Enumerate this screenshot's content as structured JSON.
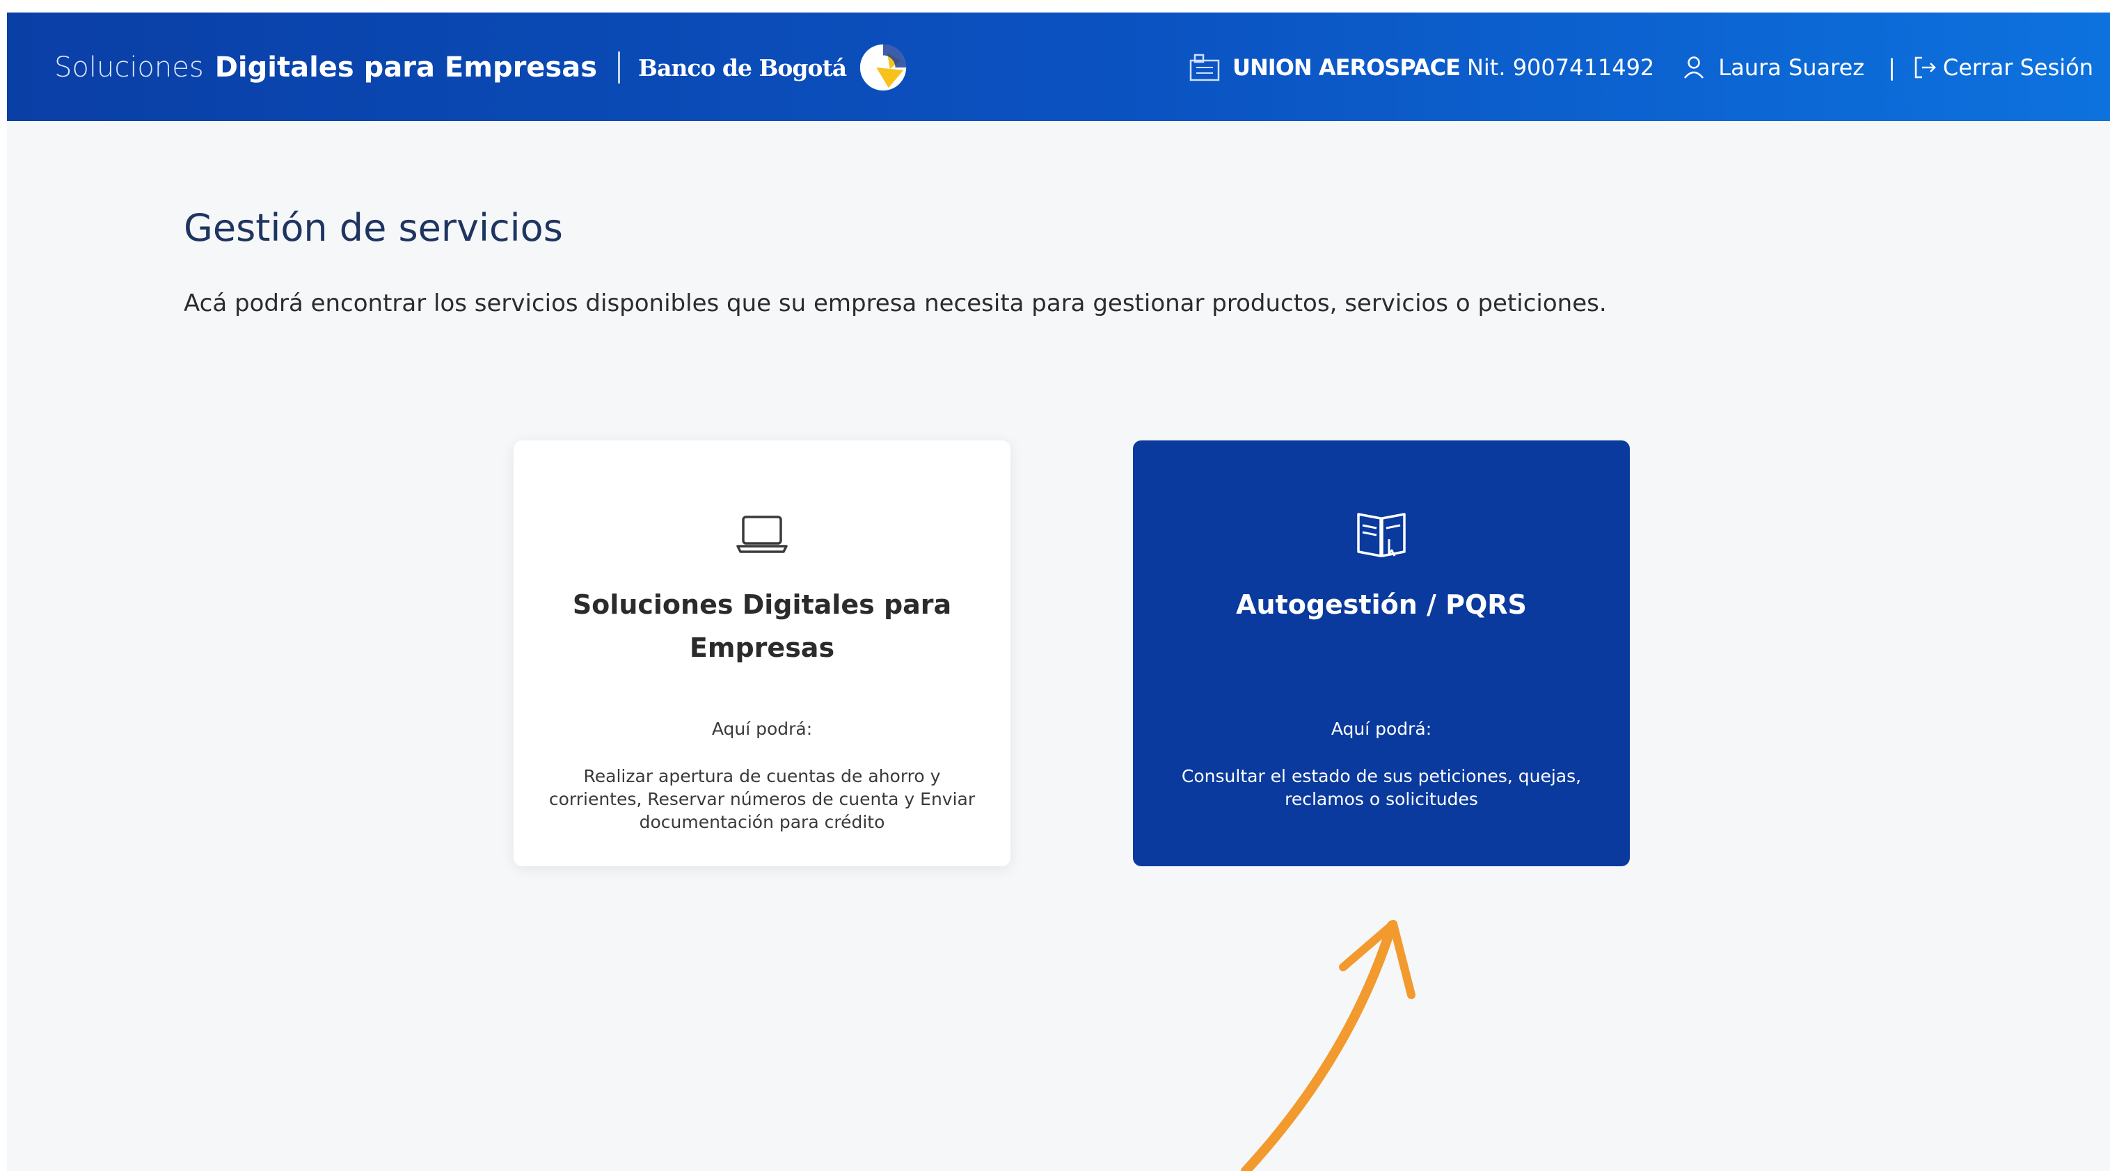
{
  "header": {
    "brand_prefix": "Soluciones",
    "brand_main": "Digitales para Empresas",
    "bank_name": "Banco de Bogotá",
    "company_name": "UNION AEROSPACE",
    "company_nit": "Nit. 9007411492",
    "user_name": "Laura Suarez",
    "separator": "|",
    "logout_label": "Cerrar Sesión"
  },
  "main": {
    "title": "Gestión de servicios",
    "description": "Acá podrá encontrar los servicios disponibles que su empresa necesita para gestionar productos, servicios o peticiones."
  },
  "cards": [
    {
      "icon": "laptop-icon",
      "title": "Soluciones Digitales para Empresas",
      "subtitle": "Aquí podrá:",
      "text": "Realizar apertura de cuentas de ahorro y corrientes, Reservar números de cuenta y Enviar documentación para crédito"
    },
    {
      "icon": "book-pointer-icon",
      "title": "Autogestión / PQRS",
      "subtitle": "Aquí podrá:",
      "text": "Consultar el estado de sus peticiones, quejas, reclamos o solicitudes"
    }
  ],
  "colors": {
    "header_start": "#0a3fa6",
    "header_end": "#0d72de",
    "card_active": "#0a3a9e",
    "page_bg": "#f5f7f9",
    "title": "#1f3460",
    "annotation_arrow": "#f29a2e"
  }
}
